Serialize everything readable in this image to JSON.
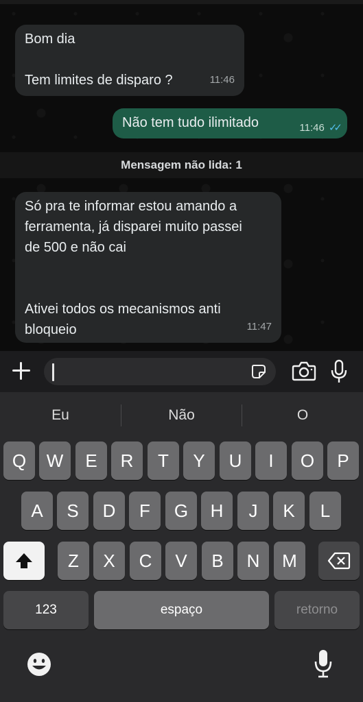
{
  "chat": {
    "messages": [
      {
        "direction": "in",
        "text": "Bom dia\n\nTem limites de disparo ?",
        "time": "11:46"
      },
      {
        "direction": "out",
        "text": "Não tem tudo ilimitado",
        "time": "11:46",
        "status": "read"
      },
      {
        "direction": "in",
        "text": "Só pra te informar estou amando a\nferramenta, já disparei muito passei\nde 500 e não cai\n\n\nAtivei todos os mecanismos anti\nbloqueio",
        "time": "11:47"
      }
    ],
    "unread_divider": "Mensagem não lida: 1"
  },
  "input_bar": {
    "placeholder": "",
    "value": "",
    "icons": [
      "plus-icon",
      "sticker-icon",
      "camera-icon",
      "mic-icon"
    ]
  },
  "keyboard": {
    "suggestions": [
      "Eu",
      "Não",
      "O"
    ],
    "row1": [
      "Q",
      "W",
      "E",
      "R",
      "T",
      "Y",
      "U",
      "I",
      "O",
      "P"
    ],
    "row2": [
      "A",
      "S",
      "D",
      "F",
      "G",
      "H",
      "J",
      "K",
      "L"
    ],
    "row3": [
      "Z",
      "X",
      "C",
      "V",
      "B",
      "N",
      "M"
    ],
    "numbers_label": "123",
    "space_label": "espaço",
    "return_label": "retorno",
    "icons": [
      "shift-icon",
      "backspace-icon",
      "emoji-icon",
      "dictation-mic-icon"
    ]
  },
  "colors": {
    "incoming_bubble": "#262829",
    "outgoing_bubble": "#1e5c47",
    "read_ticks": "#53bdeb"
  }
}
